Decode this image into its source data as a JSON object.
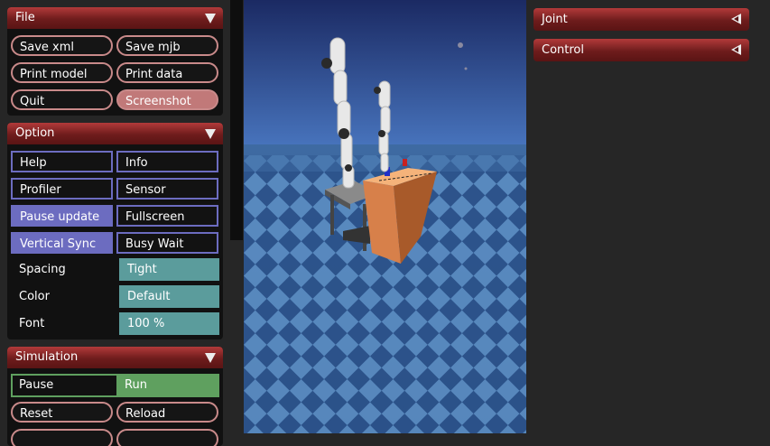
{
  "file": {
    "title": "File",
    "buttons": [
      "Save xml",
      "Save mjb",
      "Print model",
      "Print data",
      "Quit",
      "Screenshot"
    ]
  },
  "option": {
    "title": "Option",
    "toggles": [
      "Help",
      "Info",
      "Profiler",
      "Sensor",
      "Pause update",
      "Fullscreen",
      "Vertical Sync",
      "Busy Wait"
    ],
    "selects": [
      {
        "label": "Spacing",
        "value": "Tight"
      },
      {
        "label": "Color",
        "value": "Default"
      },
      {
        "label": "Font",
        "value": "100 %"
      }
    ]
  },
  "simulation": {
    "title": "Simulation",
    "mode": [
      "Pause",
      "Run"
    ],
    "buttons": [
      "Reset",
      "Reload"
    ]
  },
  "right_panels": {
    "joint": "Joint",
    "control": "Control"
  },
  "colors": {
    "header_red": "#8b2a2a",
    "round_border": "#c98a8a",
    "toggle_blue": "#6c6cc0",
    "select_teal": "#5b9c9c",
    "run_green": "#5fa05f"
  }
}
